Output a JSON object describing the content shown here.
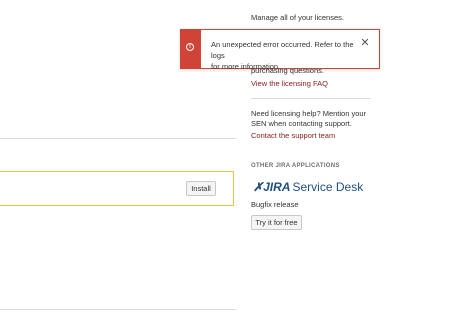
{
  "sidebar": {
    "manage_text": "Manage all of your licenses.",
    "purchasing_text": "purchasing questions.",
    "faq_link": "View the licensing FAQ",
    "help_line1": "Need licensing help? Mention your",
    "help_line2": "SEN when contacting support.",
    "support_link": "Contact the support team",
    "other_apps_heading": "OTHER JIRA APPLICATIONS",
    "logo": {
      "jira": "JIRA",
      "product": "Service Desk"
    },
    "release_label": "Bugfix release",
    "try_button": "Try it for free"
  },
  "error_flag": {
    "line1": "An unexpected error occurred. Refer to the logs",
    "line2": "for more information.",
    "icon": "error-icon",
    "close_icon": "close-icon"
  },
  "main": {
    "install_button": "Install"
  },
  "colors": {
    "error": "#d04437",
    "link": "#8b1a1a",
    "card_border": "#f0c244",
    "brand": "#205081"
  }
}
